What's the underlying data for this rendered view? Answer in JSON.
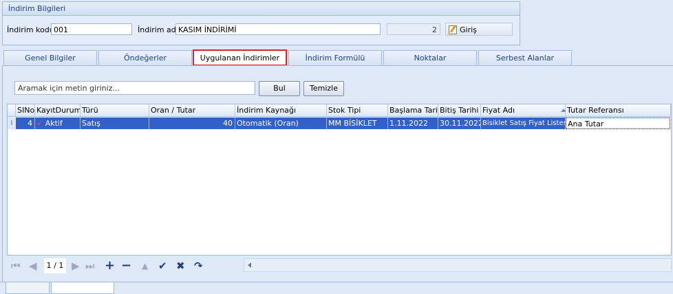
{
  "group": {
    "title": "İndirim Bilgileri",
    "code_label": "İndirim kodu",
    "code_value": "001",
    "name_label": "İndirim adı",
    "name_value": "KASIM İNDİRİMİ",
    "count_value": "2",
    "giris_label": "Giriş"
  },
  "tabs": [
    {
      "label": "Genel Bilgiler"
    },
    {
      "label": "Öndeğerler"
    },
    {
      "label": "Uygulanan İndirimler",
      "active": true
    },
    {
      "label": "İndirim Formülü"
    },
    {
      "label": "Noktalar"
    },
    {
      "label": "Serbest Alanlar"
    }
  ],
  "search": {
    "placeholder": "Aramak için metin giriniz...",
    "find_label": "Bul",
    "clear_label": "Temizle"
  },
  "grid": {
    "columns": [
      "SINo",
      "KayıtDurumu",
      "Türü",
      "Oran / Tutar",
      "İndirim Kaynağı",
      "Stok Tipi",
      "Başlama Tarihi",
      "Bitiş Tarihi",
      "Fiyat Adı",
      "Tutar Referansı"
    ],
    "rows": [
      {
        "row_marker": "I",
        "sino": "4",
        "durum": "Aktif",
        "turu": "Satış",
        "oran": "40",
        "kaynak": "Otomatik (Oran)",
        "stok_tipi": "MM BİSİKLET",
        "baslama": "1.11.2022",
        "bitis": "30.11.2022",
        "fiyat_adi": "Bisiklet Satış Fiyat Listesi",
        "tutar_ref": "Ana Tutar"
      }
    ]
  },
  "navigator": {
    "page": "1 / 1",
    "icons": [
      "first-icon",
      "prev-icon",
      "next-icon",
      "last-icon",
      "add-icon",
      "remove-icon",
      "up-icon",
      "check-icon",
      "cancel-icon",
      "refresh-icon"
    ]
  },
  "colors": {
    "selected_row": "#3060c8",
    "active_tab_border": "#d8232a",
    "accent": "#15428b"
  }
}
